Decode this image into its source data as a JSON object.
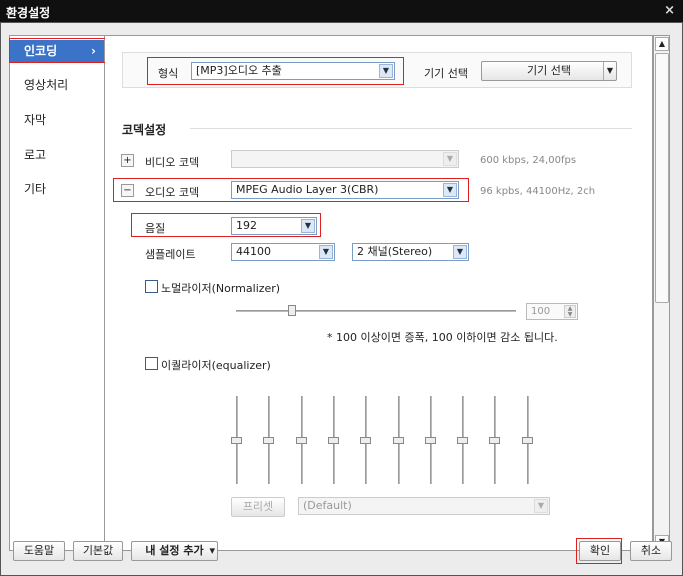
{
  "window": {
    "title": "환경설정",
    "close_glyph": "×"
  },
  "sidebar": {
    "items": [
      {
        "label": "인코딩",
        "chevron": "›"
      },
      {
        "label": "영상처리"
      },
      {
        "label": "자막"
      },
      {
        "label": "로고"
      },
      {
        "label": "기타"
      }
    ]
  },
  "format": {
    "label": "형식",
    "value": "[MP3]오디오 추출",
    "device_label": "기기 선택",
    "device_button": "기기 선택"
  },
  "codec_settings": {
    "title": "코덱설정",
    "video": {
      "toggle": "+",
      "label": "비디오 코덱",
      "value": "",
      "info": "600 kbps, 24,00fps"
    },
    "audio": {
      "toggle": "−",
      "label": "오디오 코덱",
      "value": "MPEG Audio Layer 3(CBR)",
      "info": "96 kpbs, 44100Hz, 2ch"
    },
    "quality": {
      "label": "음질",
      "value": "192"
    },
    "samplerate": {
      "label": "샘플레이트",
      "value": "44100",
      "channels": "2 채널(Stereo)"
    }
  },
  "normalizer": {
    "label": "노멀라이저(Normalizer)",
    "checked": false,
    "value": "100",
    "level": 0.2,
    "note": "* 100 이상이면 증폭, 100 이하이면 감소 됩니다."
  },
  "equalizer": {
    "label": "이퀄라이저(equalizer)",
    "checked": false,
    "bands": 10,
    "preset_button": "프리셋",
    "preset_value": "(Default)"
  },
  "footer": {
    "help": "도움말",
    "default": "기본값",
    "add_setting": "내 설정 추가",
    "add_arrow": "▾",
    "ok": "확인",
    "cancel": "취소"
  }
}
